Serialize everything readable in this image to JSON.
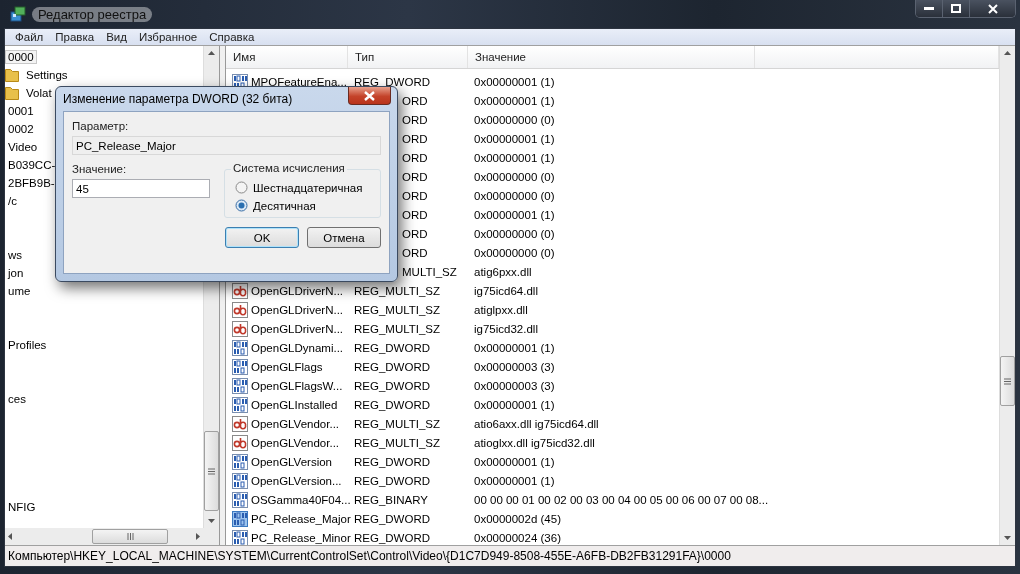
{
  "window": {
    "title": "Редактор реестра"
  },
  "menu": [
    "Файл",
    "Правка",
    "Вид",
    "Избранное",
    "Справка"
  ],
  "tree": [
    {
      "kind": "key",
      "text": "0000",
      "selected": true
    },
    {
      "kind": "folder",
      "text": "Settings",
      "selected": false
    },
    {
      "kind": "folder",
      "text": "Volat",
      "selected": false
    },
    {
      "kind": "key",
      "text": "0001",
      "selected": false
    },
    {
      "kind": "key",
      "text": "0002",
      "selected": false
    },
    {
      "kind": "key",
      "text": "Video",
      "selected": false
    },
    {
      "kind": "key",
      "text": "B039CC-",
      "selected": false
    },
    {
      "kind": "key",
      "text": "2BFB9B-",
      "selected": false
    },
    {
      "kind": "key",
      "text": "/c",
      "selected": false
    },
    {
      "kind": "blank"
    },
    {
      "kind": "blank"
    },
    {
      "kind": "key",
      "text": "ws",
      "selected": false
    },
    {
      "kind": "key",
      "text": "jon",
      "selected": false
    },
    {
      "kind": "key",
      "text": "ume",
      "selected": false
    },
    {
      "kind": "blank"
    },
    {
      "kind": "blank"
    },
    {
      "kind": "key",
      "text": "Profiles",
      "selected": false
    },
    {
      "kind": "blank"
    },
    {
      "kind": "blank"
    },
    {
      "kind": "key",
      "text": "ces",
      "selected": false
    },
    {
      "kind": "blank"
    },
    {
      "kind": "blank"
    },
    {
      "kind": "blank"
    },
    {
      "kind": "blank"
    },
    {
      "kind": "blank"
    },
    {
      "kind": "key",
      "text": "NFIG",
      "selected": false
    }
  ],
  "table": {
    "columns": [
      "Имя",
      "Тип",
      "Значение"
    ],
    "rows": [
      {
        "kind": "binary",
        "name": "MPOFeatureEna...",
        "type": "REG_DWORD",
        "value": "0x00000001 (1)",
        "selected": false
      },
      {
        "kind": "covered",
        "type": "ORD",
        "value": "0x00000001 (1)"
      },
      {
        "kind": "covered",
        "type": "ORD",
        "value": "0x00000000 (0)"
      },
      {
        "kind": "covered",
        "type": "ORD",
        "value": "0x00000001 (1)"
      },
      {
        "kind": "covered",
        "type": "ORD",
        "value": "0x00000001 (1)"
      },
      {
        "kind": "covered",
        "type": "ORD",
        "value": "0x00000000 (0)"
      },
      {
        "kind": "covered",
        "type": "ORD",
        "value": "0x00000000 (0)"
      },
      {
        "kind": "covered",
        "type": "ORD",
        "value": "0x00000001 (1)"
      },
      {
        "kind": "covered",
        "type": "ORD",
        "value": "0x00000000 (0)"
      },
      {
        "kind": "covered",
        "type": "ORD",
        "value": "0x00000000 (0)"
      },
      {
        "kind": "covered",
        "type": "MULTI_SZ",
        "value": "atig6pxx.dll"
      },
      {
        "kind": "string",
        "name": "OpenGLDriverN...",
        "type": "REG_MULTI_SZ",
        "value": "ig75icd64.dll",
        "selected": false
      },
      {
        "kind": "string",
        "name": "OpenGLDriverN...",
        "type": "REG_MULTI_SZ",
        "value": "atiglpxx.dll",
        "selected": false
      },
      {
        "kind": "string",
        "name": "OpenGLDriverN...",
        "type": "REG_MULTI_SZ",
        "value": "ig75icd32.dll",
        "selected": false
      },
      {
        "kind": "binary",
        "name": "OpenGLDynami...",
        "type": "REG_DWORD",
        "value": "0x00000001 (1)",
        "selected": false
      },
      {
        "kind": "binary",
        "name": "OpenGLFlags",
        "type": "REG_DWORD",
        "value": "0x00000003 (3)",
        "selected": false
      },
      {
        "kind": "binary",
        "name": "OpenGLFlagsW...",
        "type": "REG_DWORD",
        "value": "0x00000003 (3)",
        "selected": false
      },
      {
        "kind": "binary",
        "name": "OpenGLInstalled",
        "type": "REG_DWORD",
        "value": "0x00000001 (1)",
        "selected": false
      },
      {
        "kind": "string",
        "name": "OpenGLVendor...",
        "type": "REG_MULTI_SZ",
        "value": "atio6axx.dll ig75icd64.dll",
        "selected": false
      },
      {
        "kind": "string",
        "name": "OpenGLVendor...",
        "type": "REG_MULTI_SZ",
        "value": "atioglxx.dll ig75icd32.dll",
        "selected": false
      },
      {
        "kind": "binary",
        "name": "OpenGLVersion",
        "type": "REG_DWORD",
        "value": "0x00000001 (1)",
        "selected": false
      },
      {
        "kind": "binary",
        "name": "OpenGLVersion...",
        "type": "REG_DWORD",
        "value": "0x00000001 (1)",
        "selected": false
      },
      {
        "kind": "binary",
        "name": "OSGamma40F04...",
        "type": "REG_BINARY",
        "value": "00 00 00 01 00 02 00 03 00 04 00 05 00 06 00 07 00 08...",
        "selected": false
      },
      {
        "kind": "binary",
        "name": "PC_Release_Major",
        "type": "REG_DWORD",
        "value": "0x0000002d (45)",
        "selected": true
      },
      {
        "kind": "binary",
        "name": "PC_Release_Minor",
        "type": "REG_DWORD",
        "value": "0x00000024 (36)",
        "selected": false
      }
    ]
  },
  "status_bar": "Компьютер\\HKEY_LOCAL_MACHINE\\SYSTEM\\CurrentControlSet\\Control\\Video\\{D1C7D949-8508-455E-A6FB-DB2FB31291FA}\\0000",
  "dialog": {
    "title": "Изменение параметра DWORD (32 бита)",
    "name_label": "Параметр:",
    "name_value": "PC_Release_Major",
    "value_label": "Значение:",
    "value": "45",
    "group_label": "Система исчисления",
    "radios": [
      {
        "label": "Шестнадцатеричная",
        "selected": false
      },
      {
        "label": "Десятичная",
        "selected": true
      }
    ],
    "buttons": [
      {
        "label": "OK",
        "default": true
      },
      {
        "label": "Отмена",
        "default": false
      }
    ]
  }
}
